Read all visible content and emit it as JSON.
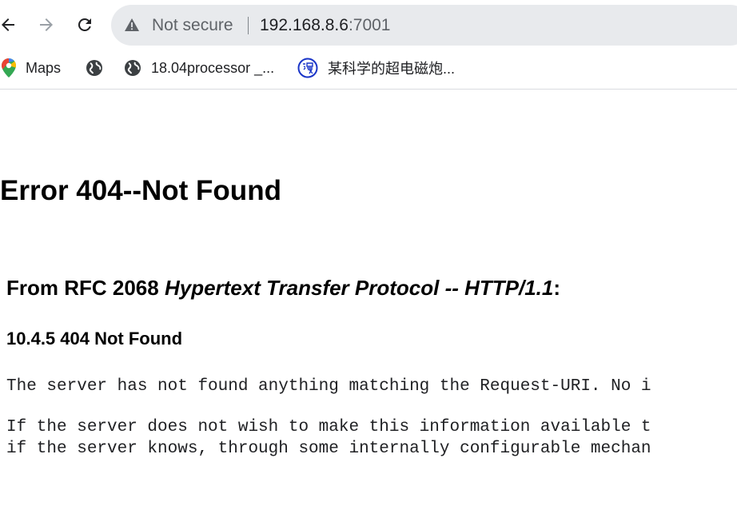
{
  "browser": {
    "security_label": "Not secure",
    "url_host": "192.168.8.6",
    "url_port": ":7001",
    "bookmarks": [
      {
        "icon": "maps-pin-icon",
        "label": "Maps"
      },
      {
        "icon": "globe-icon",
        "label": ""
      },
      {
        "icon": "globe-icon",
        "label": "18.04processor _..."
      },
      {
        "icon": "manga-icon",
        "label": "某科学的超电磁炮..."
      }
    ]
  },
  "page": {
    "title": "Error 404--Not Found",
    "rfc_prefix": "From RFC 2068 ",
    "rfc_italic": "Hypertext Transfer Protocol -- HTTP/1.1",
    "rfc_suffix": ":",
    "section_heading": "10.4.5 404 Not Found",
    "paragraph1": "The server has not found anything matching the Request-URI. No i",
    "paragraph2_line1": "If the server does not wish to make this information available t",
    "paragraph2_line2": "if the server knows, through some internally configurable mechan"
  },
  "colors": {
    "omnibox_bg": "#e8eaed",
    "muted_text": "#5f6368",
    "manga_icon": "#1a35c8"
  }
}
